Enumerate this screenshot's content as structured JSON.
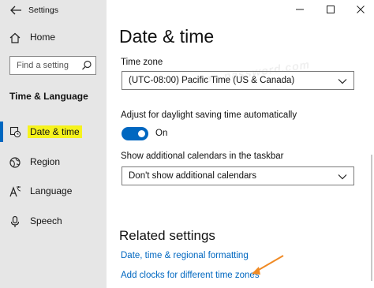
{
  "app": {
    "title": "Settings"
  },
  "sidebar": {
    "home_label": "Home",
    "search_placeholder": "Find a setting",
    "section_heading": "Time & Language",
    "items": [
      {
        "label": "Date & time",
        "icon": "date-time-icon",
        "selected": true
      },
      {
        "label": "Region",
        "icon": "globe-icon",
        "selected": false
      },
      {
        "label": "Language",
        "icon": "language-icon",
        "selected": false
      },
      {
        "label": "Speech",
        "icon": "microphone-icon",
        "selected": false
      }
    ]
  },
  "main": {
    "page_title": "Date & time",
    "time_zone": {
      "label": "Time zone",
      "value": "(UTC-08:00) Pacific Time (US & Canada)"
    },
    "daylight": {
      "label": "Adjust for daylight saving time automatically",
      "state": "On",
      "on": true
    },
    "calendars": {
      "label": "Show additional calendars in the taskbar",
      "value": "Don't show additional calendars"
    },
    "related": {
      "heading": "Related settings",
      "links": [
        "Date, time & regional formatting",
        "Add clocks for different time zones"
      ]
    }
  },
  "watermark": "top-password.com",
  "colors": {
    "accent": "#0067c0",
    "highlight": "#f6f31d",
    "annotation_arrow": "#f08a24",
    "sidebar_bg": "#e6e6e6"
  }
}
